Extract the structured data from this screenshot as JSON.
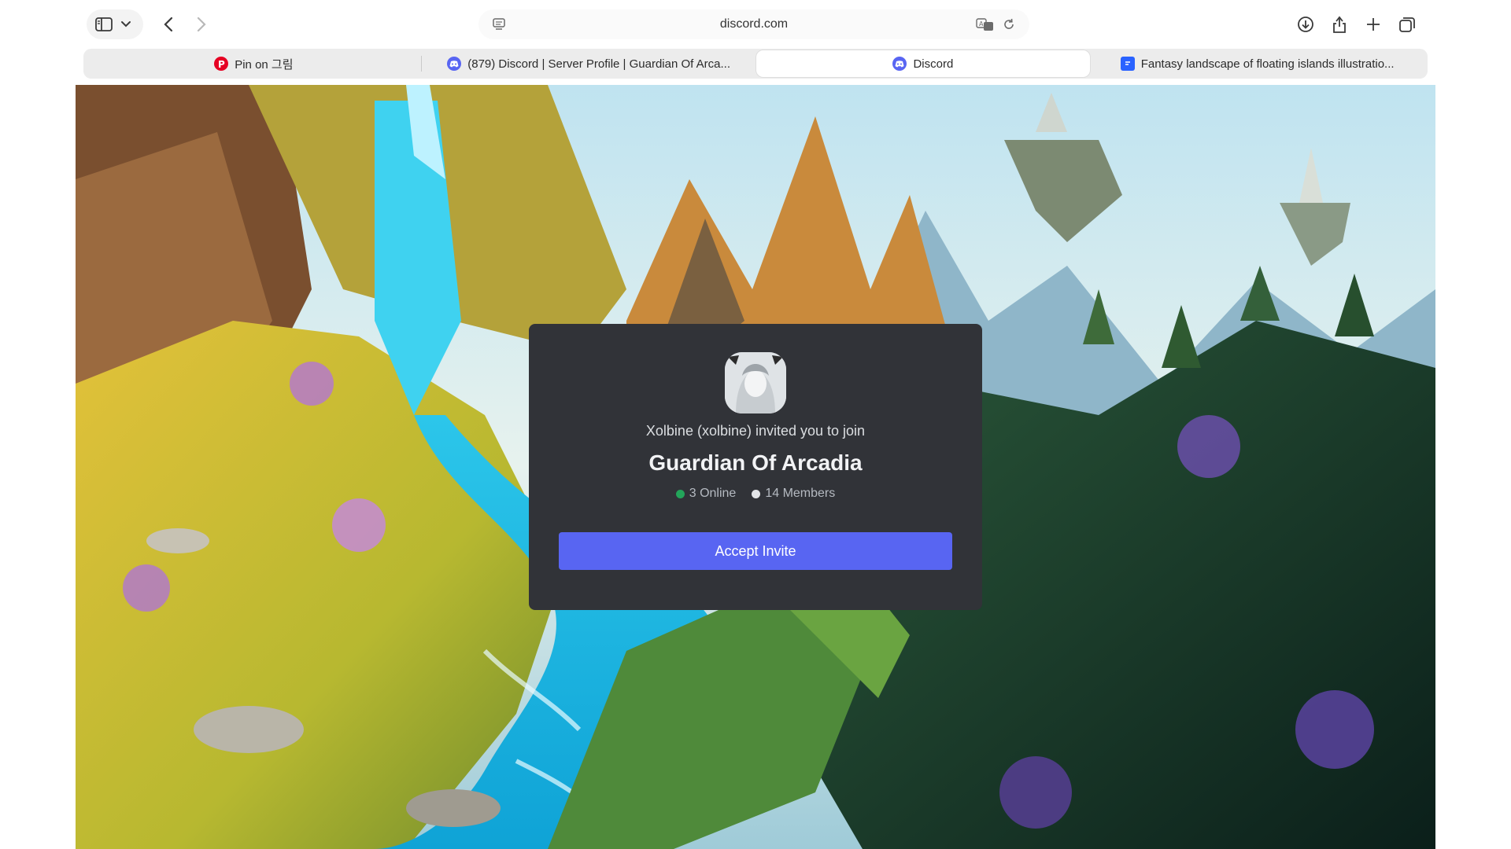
{
  "browser": {
    "url": "discord.com",
    "tabs": [
      {
        "label": "Pin on 그림",
        "favicon_color": "#e60023"
      },
      {
        "label": "(879) Discord | Server Profile | Guardian Of Arca...",
        "favicon_color": "#5865f2"
      },
      {
        "label": "Discord",
        "favicon_color": "#5865f2",
        "active": true
      },
      {
        "label": "Fantasy landscape of floating islands illustratio...",
        "favicon_color": "#2962ff"
      }
    ]
  },
  "invite": {
    "inviter_text": "Xolbine (xolbine) invited you to join",
    "server_name": "Guardian Of Arcadia",
    "online": "3 Online",
    "members": "14 Members",
    "accept_label": "Accept Invite",
    "online_color": "#23a55a",
    "members_color": "#e3e5e8",
    "button_color": "#5865f2"
  }
}
